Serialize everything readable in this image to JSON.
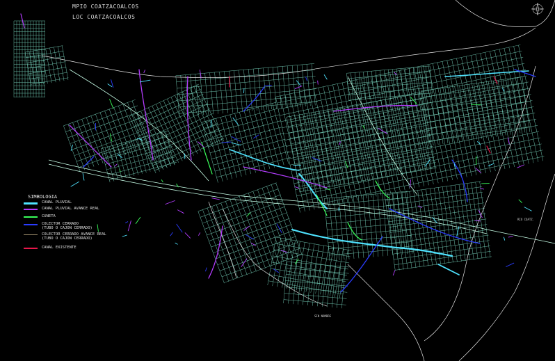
{
  "header": {
    "title_line1": "MPIO COATZACOALCOS",
    "title_line2": "LOC COATZACOALCOS"
  },
  "legend": {
    "heading": "SIMBOLOGIA",
    "items": [
      {
        "label": "CANAL PLUVIAL",
        "color": "#4fe3ff",
        "weight": 3
      },
      {
        "label": "CANAL PLUVIAL AVANCE REAL",
        "color": "#b43cff",
        "weight": 2
      },
      {
        "label": "CUNETA",
        "color": "#39ff5a",
        "weight": 2
      },
      {
        "label": "COLECTOR CERRADO\n(TUBO O CAJON CERRADO)",
        "color": "#2a3cff",
        "weight": 2
      },
      {
        "label": "COLECTOR CERRADO AVANCE REAL\n(TUBO O CAJON CERRADO)",
        "color": "#9a8a6a",
        "weight": 1
      },
      {
        "label": "CANAL EXISTENTE",
        "color": "#e8174a",
        "weight": 2
      }
    ]
  },
  "map_labels": {
    "river_label": "RIO COATZ.",
    "south_label": "SIN NOMBRE"
  },
  "colors": {
    "background": "#000000",
    "streets": "#7fe0c8",
    "coast": "#e6e6e6",
    "canal_pluvial": "#4fe3ff",
    "avance_real": "#b43cff",
    "cuneta": "#39ff5a",
    "colector": "#2a3cff",
    "existente": "#e8174a"
  }
}
